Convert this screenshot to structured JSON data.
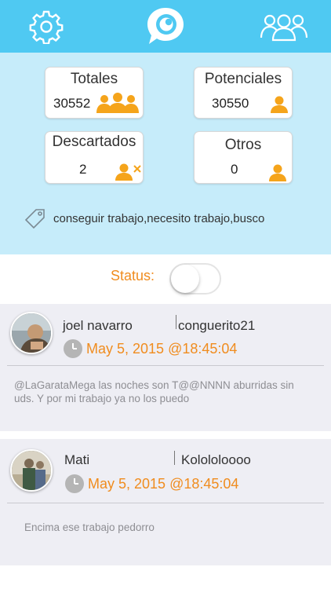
{
  "topbar": {
    "settings_icon": "gear-icon",
    "logo_icon": "chat-bubble-eye-logo",
    "users_icon": "users-group-icon"
  },
  "stats": {
    "totales": {
      "label": "Totales",
      "value": "30552"
    },
    "potenciales": {
      "label": "Potenciales",
      "value": "30550"
    },
    "descartados": {
      "label": "Descartados",
      "value": "2"
    },
    "otros": {
      "label": "Otros",
      "value": "0"
    }
  },
  "keywords": "conseguir trabajo,necesito trabajo,busco",
  "status": {
    "label": "Status:",
    "enabled": false
  },
  "feed": [
    {
      "name": "joel navarro",
      "handle": "conguerito21",
      "date": "May  5, 2015 @18:45:04",
      "text": "@LaGarataMega las noches son T@@NNNN aburridas sin uds. Y por mi trabajo ya no los puedo"
    },
    {
      "name": "Mati",
      "handle": "Kolololoooo",
      "date": "May  5, 2015 @18:45:04",
      "text": "Encima ese trabajo pedorro"
    }
  ],
  "colors": {
    "topbar": "#4fc9f2",
    "panel": "#c6ecfa",
    "accent": "#f08c1e",
    "feed_bg": "#eeeef4"
  }
}
